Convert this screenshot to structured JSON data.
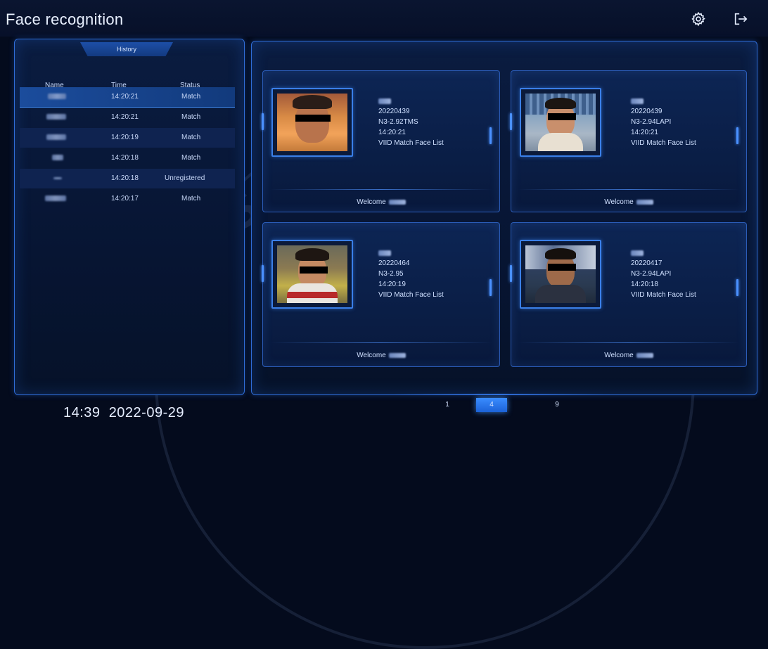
{
  "header": {
    "title": "Face recognition",
    "settings_icon": "gear-icon",
    "exit_icon": "logout-icon"
  },
  "history": {
    "tab_label": "History",
    "columns": [
      "Name",
      "Time",
      "Status"
    ],
    "rows": [
      {
        "time": "14:20:21",
        "status": "Match"
      },
      {
        "time": "14:20:21",
        "status": "Match"
      },
      {
        "time": "14:20:19",
        "status": "Match"
      },
      {
        "time": "14:20:18",
        "status": "Match"
      },
      {
        "time": "14:20:18",
        "status": "Unregistered"
      },
      {
        "time": "14:20:17",
        "status": "Match"
      }
    ]
  },
  "cards": [
    {
      "id": "20220439",
      "device": "N3-2.92TMS",
      "time": "14:20:21",
      "list": "VIID Match Face List",
      "welcome": "Welcome"
    },
    {
      "id": "20220439",
      "device": "N3-2.94LAPI",
      "time": "14:20:21",
      "list": "VIID Match Face List",
      "welcome": "Welcome"
    },
    {
      "id": "20220464",
      "device": "N3-2.95",
      "time": "14:20:19",
      "list": "VIID Match Face List",
      "welcome": "Welcome"
    },
    {
      "id": "20220417",
      "device": "N3-2.94LAPI",
      "time": "14:20:18",
      "list": "VIID Match Face List",
      "welcome": "Welcome"
    }
  ],
  "pagination": {
    "pages": [
      "1",
      "4",
      "9"
    ],
    "active": "4"
  },
  "footer": {
    "time": "14:39",
    "date": "2022-09-29"
  },
  "watermark": {
    "text": "SAM DISTRIBUTION"
  },
  "colors": {
    "accent": "#3a8cff",
    "background": "#040b1d",
    "panel_border": "#2f6cd6"
  }
}
